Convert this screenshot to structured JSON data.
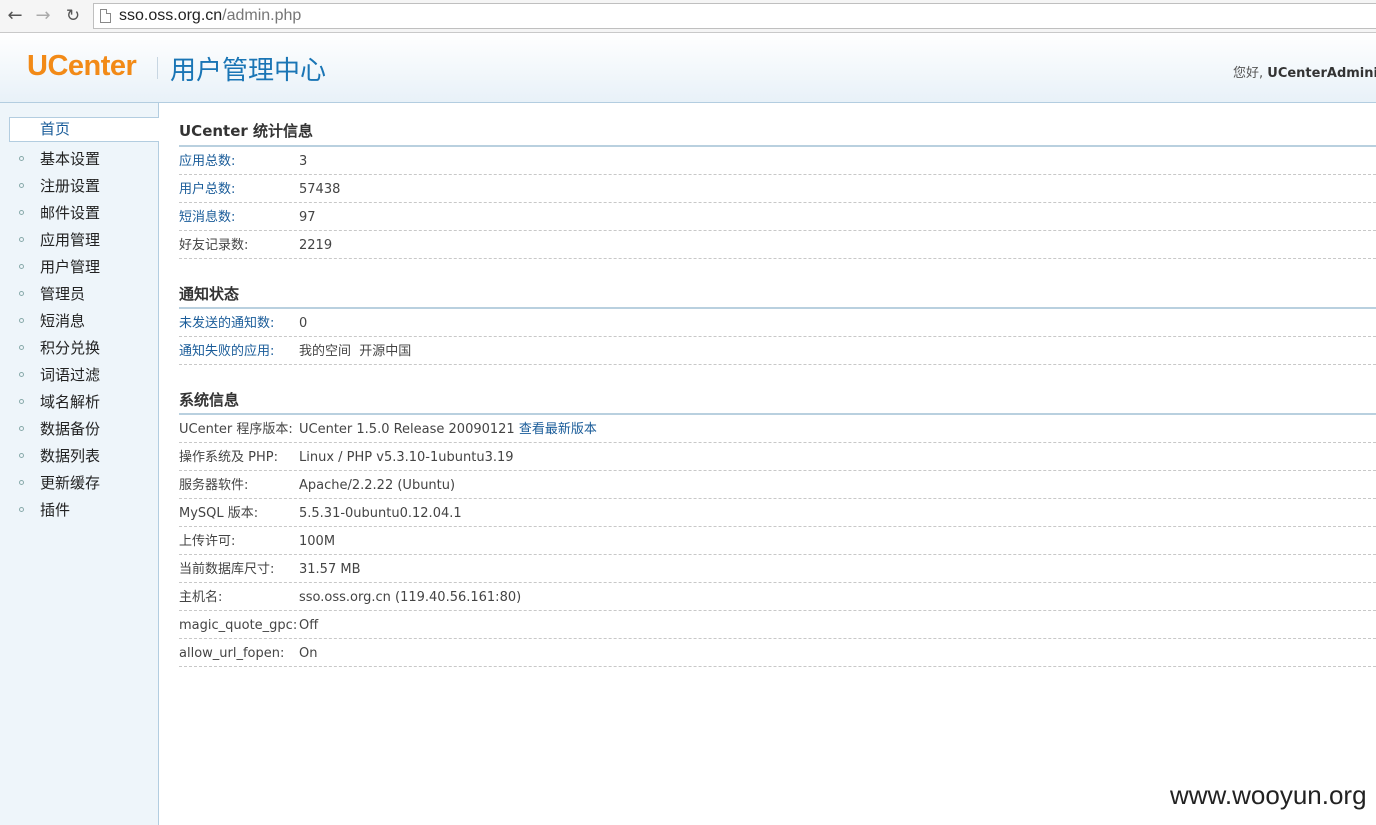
{
  "browser": {
    "url_host": "sso.oss.org.cn",
    "url_path": "/admin.php"
  },
  "header": {
    "logo": "UCenter",
    "title": "用户管理中心",
    "greeting_prefix": "您好, ",
    "username": "UCenterAdminist"
  },
  "sidebar": {
    "items": [
      {
        "label": "首页"
      },
      {
        "label": "基本设置"
      },
      {
        "label": "注册设置"
      },
      {
        "label": "邮件设置"
      },
      {
        "label": "应用管理"
      },
      {
        "label": "用户管理"
      },
      {
        "label": "管理员"
      },
      {
        "label": "短消息"
      },
      {
        "label": "积分兑换"
      },
      {
        "label": "词语过滤"
      },
      {
        "label": "域名解析"
      },
      {
        "label": "数据备份"
      },
      {
        "label": "数据列表"
      },
      {
        "label": "更新缓存"
      },
      {
        "label": "插件"
      }
    ]
  },
  "stats": {
    "title": "UCenter 统计信息",
    "rows": [
      {
        "key": "应用总数:",
        "value": "3"
      },
      {
        "key": "用户总数:",
        "value": "57438"
      },
      {
        "key": "短消息数:",
        "value": "97"
      },
      {
        "key": "好友记录数:",
        "value": "2219"
      }
    ]
  },
  "notify": {
    "title": "通知状态",
    "rows": [
      {
        "key": "未发送的通知数:",
        "value": "0"
      },
      {
        "key": "通知失败的应用:",
        "value": "我的空间  开源中国"
      }
    ]
  },
  "sysinfo": {
    "title": "系统信息",
    "version_key": "UCenter 程序版本:",
    "version_value": "UCenter 1.5.0 Release 20090121",
    "version_link": "查看最新版本",
    "rows": [
      {
        "key": "操作系统及 PHP:",
        "value": "Linux / PHP v5.3.10-1ubuntu3.19"
      },
      {
        "key": "服务器软件:",
        "value": "Apache/2.2.22 (Ubuntu)"
      },
      {
        "key": "MySQL 版本:",
        "value": "5.5.31-0ubuntu0.12.04.1"
      },
      {
        "key": "上传许可:",
        "value": "100M"
      },
      {
        "key": "当前数据库尺寸:",
        "value": "31.57 MB"
      },
      {
        "key": "主机名:",
        "value": "sso.oss.org.cn (119.40.56.161:80)"
      },
      {
        "key": "magic_quote_gpc:",
        "value": "Off"
      },
      {
        "key": "allow_url_fopen:",
        "value": "On"
      }
    ]
  },
  "watermark": "www.wooyun.org"
}
